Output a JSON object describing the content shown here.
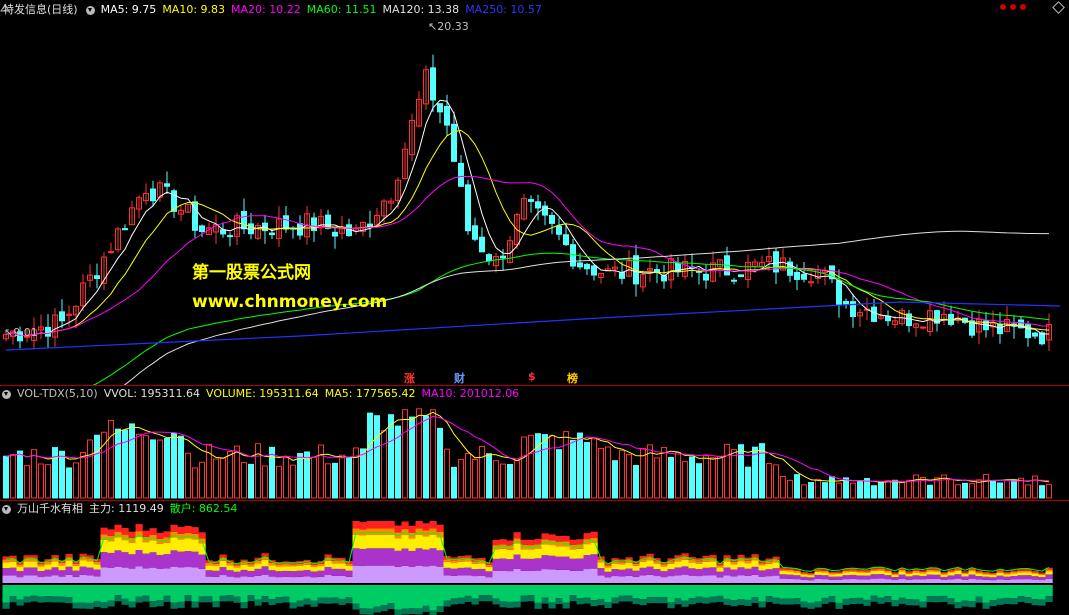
{
  "main": {
    "title": "特发信息(日线)",
    "ma": [
      {
        "label": "MA5: 9.75",
        "color": "#ffffff"
      },
      {
        "label": "MA10: 9.83",
        "color": "#ffff00"
      },
      {
        "label": "MA20: 10.22",
        "color": "#ff00ff"
      },
      {
        "label": "MA60: 11.51",
        "color": "#00ff00"
      },
      {
        "label": "MA120: 13.38",
        "color": "#e0e0e0"
      },
      {
        "label": "MA250: 10.57",
        "color": "#3333ff"
      }
    ],
    "high_label": "20.33",
    "low_label": "9.01",
    "watermark_cn": "第一股票公式网",
    "watermark_url": "www.chnmoney.com",
    "markers": [
      {
        "text": "涨",
        "color": "#ff3333"
      },
      {
        "text": "财",
        "color": "#6699ff"
      },
      {
        "text": "$",
        "color": "#ff3333"
      },
      {
        "text": "榜",
        "color": "#ffcc00"
      }
    ]
  },
  "vol": {
    "name": "VOL-TDX(5,10)",
    "vvol": "VVOL: 195311.64",
    "volume": "VOLUME: 195311.64",
    "ma5": "MA5: 177565.42",
    "ma10": "MA10: 201012.06"
  },
  "ind": {
    "name": "万山千水有相",
    "main": "主力: 1119.49",
    "retail": "散户: 862.54"
  },
  "colors": {
    "up": "#ff3232",
    "down": "#54ffff",
    "grid": "#b00000"
  }
}
